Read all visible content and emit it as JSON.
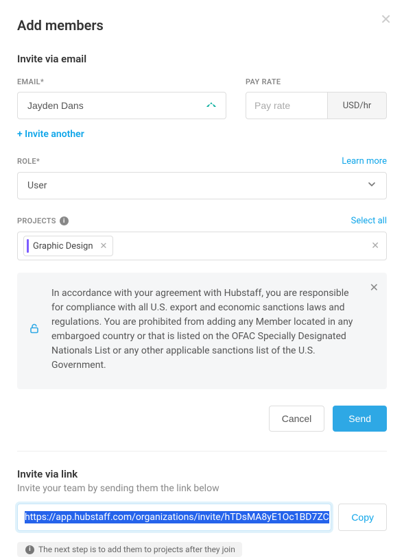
{
  "modal": {
    "title": "Add members",
    "close_aria": "Close"
  },
  "invite_email": {
    "section_title": "Invite via email",
    "email_label": "EMAIL*",
    "email_value": "Jayden Dans",
    "pay_rate_label": "PAY RATE",
    "pay_rate_placeholder": "Pay rate",
    "pay_rate_unit": "USD/hr",
    "invite_another": "+ Invite another"
  },
  "role": {
    "label": "ROLE*",
    "learn_more": "Learn more",
    "value": "User"
  },
  "projects": {
    "label": "PROJECTS",
    "select_all": "Select all",
    "chips": [
      {
        "label": "Graphic Design"
      }
    ]
  },
  "notice": {
    "text": "In accordance with your agreement with Hubstaff, you are responsible for compliance with all U.S. export and economic sanctions laws and regulations. You are prohibited from adding any Member located in any embargoed country or that is listed on the OFAC Specially Designated Nationals List or any other applicable sanctions list of the U.S. Government."
  },
  "actions": {
    "cancel": "Cancel",
    "send": "Send"
  },
  "invite_link": {
    "section_title": "Invite via link",
    "subtext": "Invite your team by sending them the link below",
    "url": "https://app.hubstaff.com/organizations/invite/hTDsMA8yE1Oc1BD7ZC",
    "copy": "Copy",
    "hint": "The next step is to add them to projects after they join"
  }
}
